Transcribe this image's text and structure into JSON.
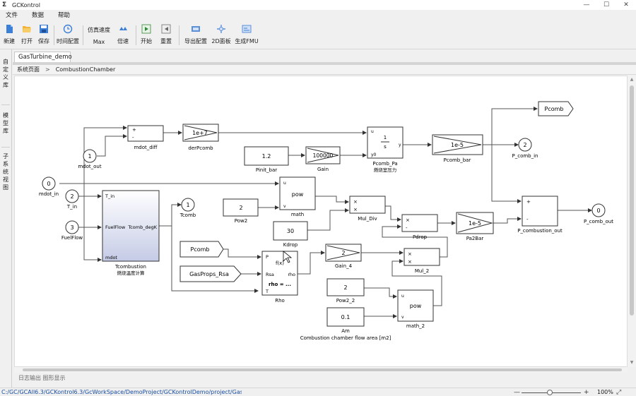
{
  "window": {
    "title": "GCKontrol",
    "minimize": "—",
    "maximize": "☐",
    "close": "✕"
  },
  "menu": [
    "文件",
    "数据",
    "帮助"
  ],
  "toolbar": {
    "new": "新建",
    "open": "打开",
    "save": "保存",
    "time_config": "时间配置",
    "sim_speed_label": "仿真速度",
    "sim_speed_value": "Max",
    "multiplier": "倍速",
    "start": "开始",
    "reset": "重置",
    "export_config": "导出配置",
    "panel_2d": "2D面板",
    "gen_fmu": "生成FMU"
  },
  "left_dock": {
    "tab1": "自定义库",
    "tab2": "模型库",
    "tab3": "子系统视图"
  },
  "doc_tab": "GasTurbine_demo",
  "breadcrumb": {
    "root": "系统页面",
    "sep": ">",
    "current": "CombustionChamber"
  },
  "output_tabs": "日志输出  图形显示",
  "statusbar": {
    "path": "C:/GC/GCAll6.3/GCKontrol6.3/GcWorkSpace/DemoProject/GCKontrolDemo/project/GasTu",
    "zoom_out": "—",
    "zoom_in": "+",
    "zoom": "100%",
    "fit": "⤢"
  },
  "diagram": {
    "ports_in": [
      {
        "num": "1",
        "name": "mdot_out"
      },
      {
        "num": "0",
        "name": "mdot_in"
      },
      {
        "num": "2",
        "name": "T_in"
      },
      {
        "num": "3",
        "name": "FuelFlow"
      }
    ],
    "ports_out": [
      {
        "num": "1",
        "name": "Tcomb"
      },
      {
        "num": "2",
        "name": "P_comb_in"
      },
      {
        "num": "0",
        "name": "P_comb_out"
      }
    ],
    "mdot_diff": {
      "name": "mdot_diff",
      "plus": "+",
      "minus": "-"
    },
    "derPcomb": {
      "name": "derPcomb",
      "value": "1e+7"
    },
    "pcomb_pa": {
      "name": "Pcomb_Pa",
      "sub": "燃烧室压力",
      "u": "u",
      "y": "y",
      "y0": "y0",
      "num": "1",
      "den": "s"
    },
    "pcomb_bar": {
      "name": "Pcomb_bar",
      "value": "1e-5"
    },
    "pcomb_goto": "Pcomb",
    "pinit_bar": {
      "name": "Pinit_bar",
      "value": "1.2"
    },
    "gain": {
      "name": "Gain",
      "value": "100000"
    },
    "math": {
      "name": "math",
      "u": "u",
      "v": "v",
      "op": "pow"
    },
    "pow2": {
      "name": "Pow2",
      "value": "2"
    },
    "mul_div": {
      "name": "Mul_Div",
      "a": "×",
      "b": "×"
    },
    "kdrop": {
      "name": "Kdrop",
      "value": "30"
    },
    "pdrop": {
      "name": "Pdrop",
      "a": "×",
      "b": "-"
    },
    "pa2bar": {
      "name": "Pa2Bar",
      "value": "1e-5"
    },
    "p_combustion_out": {
      "name": "P_combustion_out",
      "plus": "+",
      "minus": "-"
    },
    "tcombustion": {
      "name": "Tcombustion",
      "sub": "燃烧温度计算",
      "t_in": "T_in",
      "fuelflow": "FuelFlow",
      "tcomb_out": "Tcomb_degK",
      "mdot": "mdot"
    },
    "pcomb_from": "Pcomb",
    "gasprops": "GasProps_Rsa",
    "rho": {
      "name": "Rho",
      "p": "P",
      "fx": "f(x)",
      "rsa": "Rsa",
      "rho_out": "rho",
      "t": "T",
      "formula": "rho = ..."
    },
    "gain_4": {
      "name": "Gain_4",
      "value": "2"
    },
    "mul_2": {
      "name": "Mul_2",
      "a": "×",
      "b": "×"
    },
    "pow2_2": {
      "name": "Pow2_2",
      "value": "2"
    },
    "am": {
      "name": "Am",
      "value": "0.1"
    },
    "math_2": {
      "name": "math_2",
      "u": "u",
      "v": "v",
      "op": "pow"
    },
    "area_caption": "Combustion chamber flow area [m2]"
  }
}
